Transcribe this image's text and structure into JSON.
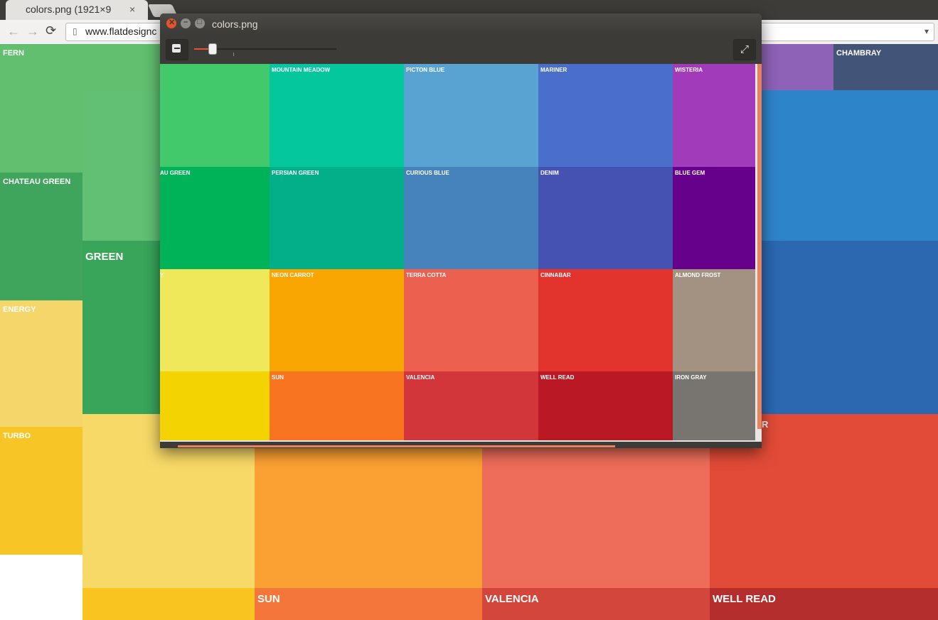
{
  "browser": {
    "tab_title": "colors.png (1921×9",
    "tab_close": "×",
    "back": "←",
    "forward": "→",
    "reload": "⟳",
    "url": "www.flatdesignc"
  },
  "background_tiles": [
    {
      "label": "FERN",
      "color": "#62bf6f"
    },
    {
      "label": "CHATEAU GREEN",
      "color": "#3fa55c"
    },
    {
      "label": "ENERGY",
      "color": "#f4d66a"
    },
    {
      "label": "TURBO",
      "color": "#f8c526"
    },
    {
      "label": "",
      "color": "#61c074"
    },
    {
      "label": "GREEN",
      "color": "#38a55b"
    },
    {
      "label": "",
      "color": "#f7d967"
    },
    {
      "label": "",
      "color": "#f9c41f"
    },
    {
      "label": "",
      "color": "#fba032"
    },
    {
      "label": "SUN",
      "color": "#f5763a"
    },
    {
      "label": "",
      "color": "#ed6d5a"
    },
    {
      "label": "VALENCIA",
      "color": "#d3463c"
    },
    {
      "label": "",
      "color": "#e24b37"
    },
    {
      "label": "WELL READ",
      "color": "#b42e2e"
    },
    {
      "label": "",
      "color": "#8e62b7"
    },
    {
      "label": "CHAMBRAY",
      "color": "#435479"
    },
    {
      "label": "",
      "color": "#2e84c9"
    },
    {
      "label": "",
      "color": "#2b68b0"
    },
    {
      "label": "R",
      "color": "#e24b37"
    }
  ],
  "viewer": {
    "title": "colors.png",
    "fullscreen_glyph": "⤢",
    "zoom_level": 0.1,
    "tiles": [
      {
        "label": "",
        "color": "#42c96b"
      },
      {
        "label": "MOUNTAIN MEADOW",
        "color": "#04c79e"
      },
      {
        "label": "PICTON BLUE",
        "color": "#59a3d3"
      },
      {
        "label": "MARINER",
        "color": "#4a6ecc"
      },
      {
        "label": "WISTERIA",
        "color": "#a23bb9"
      },
      {
        "label": "AU GREEN",
        "color": "#00b358"
      },
      {
        "label": "PERSIAN GREEN",
        "color": "#03af88"
      },
      {
        "label": "CURIOUS BLUE",
        "color": "#4683bd"
      },
      {
        "label": "DENIM",
        "color": "#4552b2"
      },
      {
        "label": "BLUE GEM",
        "color": "#66018c"
      },
      {
        "label": "Y",
        "color": "#efe85a"
      },
      {
        "label": "NEON CARROT",
        "color": "#f9a502"
      },
      {
        "label": "TERRA COTTA",
        "color": "#eb604f"
      },
      {
        "label": "CINNABAR",
        "color": "#e2332d"
      },
      {
        "label": "ALMOND FROST",
        "color": "#a39182"
      },
      {
        "label": "",
        "color": "#f3d402"
      },
      {
        "label": "SUN",
        "color": "#f97421"
      },
      {
        "label": "VALENCIA",
        "color": "#d3363a"
      },
      {
        "label": "WELL READ",
        "color": "#bb1826"
      },
      {
        "label": "IRON GRAY",
        "color": "#787470"
      }
    ]
  }
}
